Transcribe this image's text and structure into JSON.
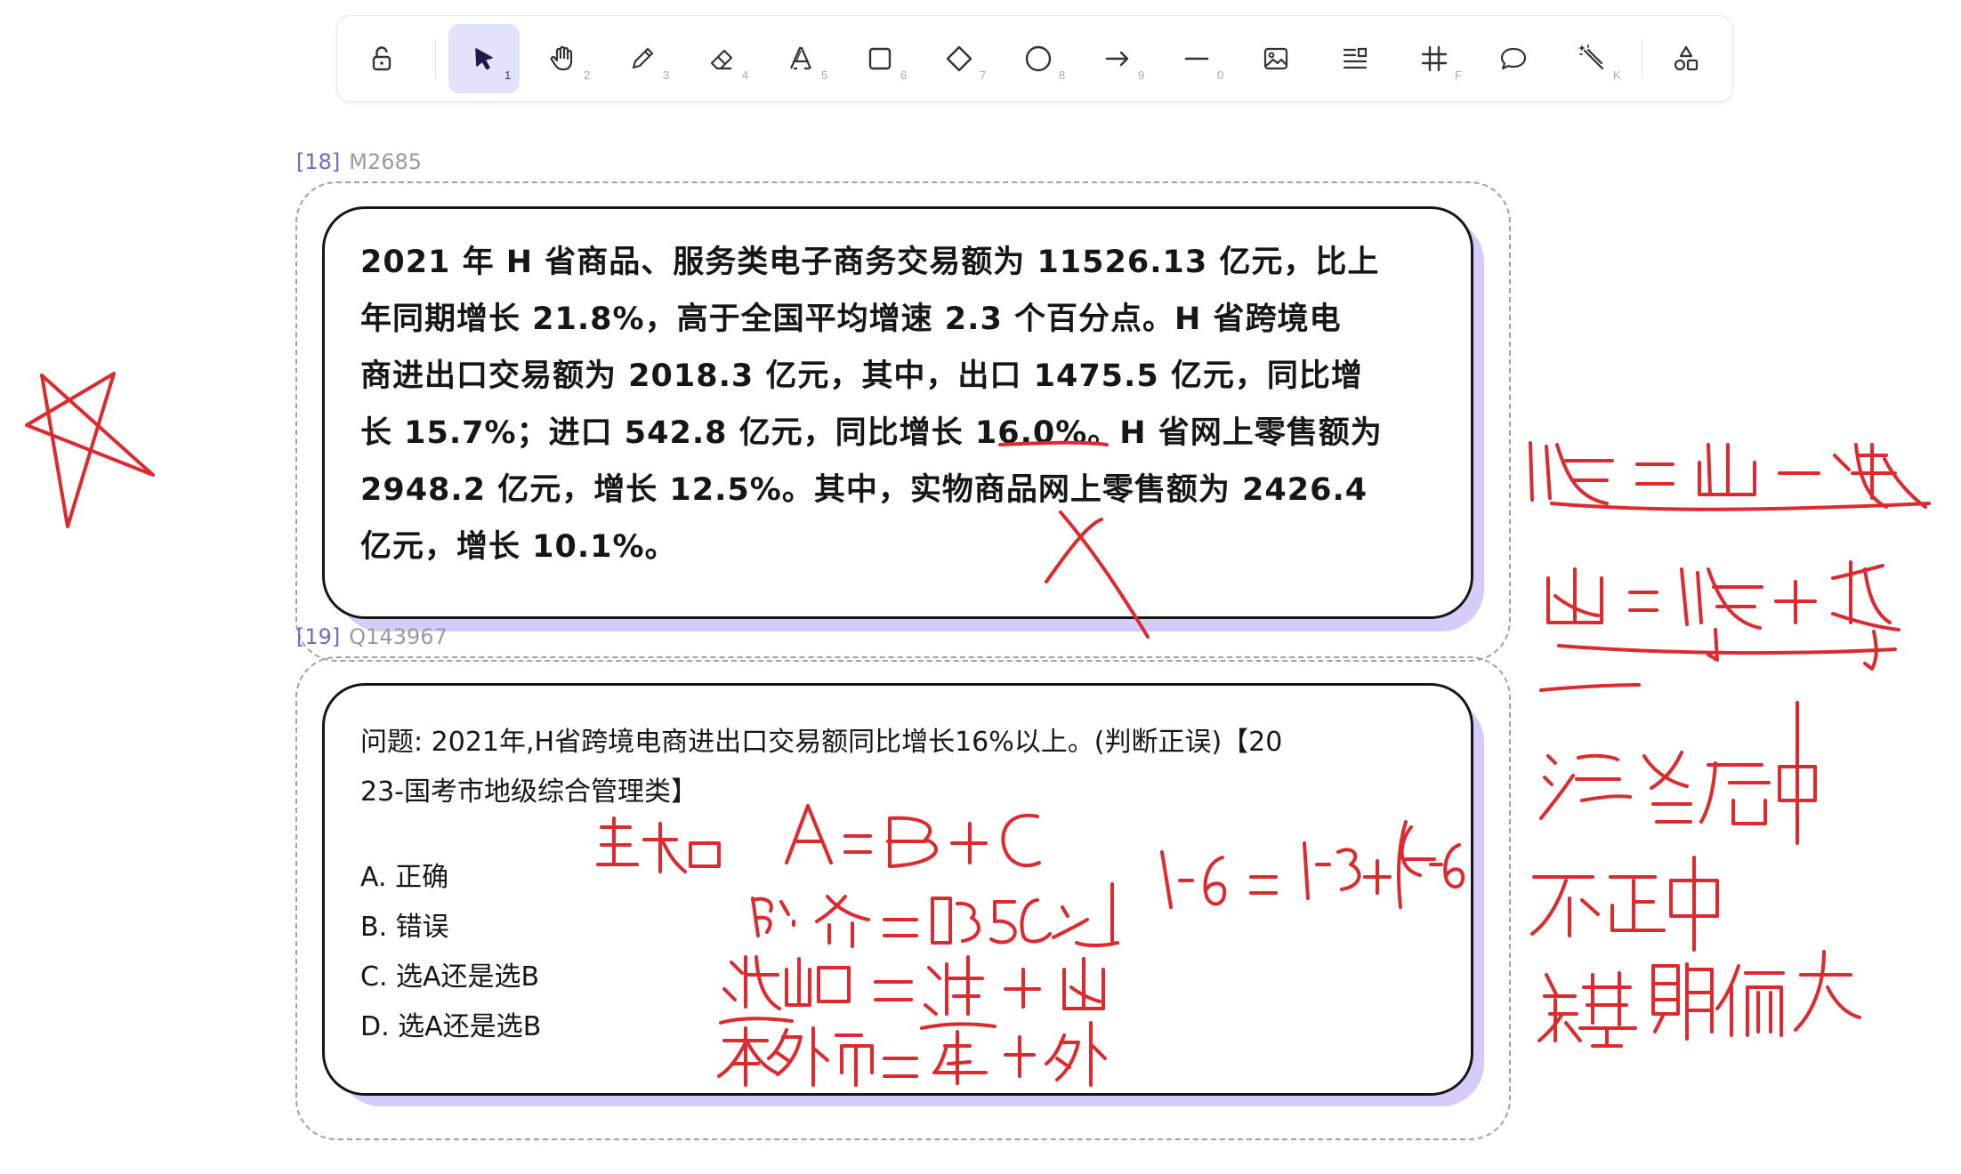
{
  "toolbar": {
    "tools": [
      {
        "id": "lock",
        "icon": "unlock-icon",
        "key": ""
      },
      {
        "id": "select",
        "icon": "select-pointer-icon",
        "key": "1",
        "active": true
      },
      {
        "id": "hand",
        "icon": "hand-icon",
        "key": "2"
      },
      {
        "id": "draw",
        "icon": "pencil-icon",
        "key": "3"
      },
      {
        "id": "eraser",
        "icon": "eraser-icon",
        "key": "4"
      },
      {
        "id": "text",
        "icon": "text-icon",
        "key": "5"
      },
      {
        "id": "rectangle",
        "icon": "rectangle-icon",
        "key": "6"
      },
      {
        "id": "diamond",
        "icon": "diamond-icon",
        "key": "7"
      },
      {
        "id": "ellipse",
        "icon": "ellipse-icon",
        "key": "8"
      },
      {
        "id": "arrow",
        "icon": "arrow-right-icon",
        "key": "9"
      },
      {
        "id": "line",
        "icon": "line-icon",
        "key": "0"
      },
      {
        "id": "image",
        "icon": "image-icon",
        "key": ""
      },
      {
        "id": "embed",
        "icon": "embed-icon",
        "key": ""
      },
      {
        "id": "frame",
        "icon": "frame-hash-icon",
        "key": "F"
      },
      {
        "id": "comment",
        "icon": "speech-bubble-icon",
        "key": ""
      },
      {
        "id": "laser",
        "icon": "magic-wand-icon",
        "key": "K"
      },
      {
        "id": "library",
        "icon": "shapes-library-icon",
        "key": ""
      }
    ],
    "accent": "#e3e2fe"
  },
  "frames": [
    {
      "index": "[18]",
      "id": "M2685"
    },
    {
      "index": "[19]",
      "id": "Q143967"
    }
  ],
  "passage": {
    "lines": [
      "2021 年 H 省商品、服务类电子商务交易额为 11526.13 亿元，比上",
      "年同期增长 21.8%，高于全国平均增速 2.3 个百分点。H 省跨境电",
      "商进出口交易额为 2018.3 亿元，其中，出口 1475.5 亿元，同比增",
      "长 15.7%；进口 542.8 亿元，同比增长 16.0%。H 省网上零售额为",
      "2948.2 亿元，增长 12.5%。其中，实物商品网上零售额为 2426.4",
      "亿元，增长 10.1%。"
    ]
  },
  "question": {
    "lines": [
      "问题: 2021年,H省跨境电商进出口交易额同比增长16%以上。(判断正误)【20",
      "23-国考市地级综合管理类】"
    ],
    "options": [
      "A. 正确",
      "B. 错误",
      "C. 选A还是选B",
      "D. 选A还是选B"
    ]
  },
  "colors": {
    "ink": "#dc2a2f",
    "card_shadow": "#d5ccfa",
    "frame_border": "#9aa2b5"
  }
}
